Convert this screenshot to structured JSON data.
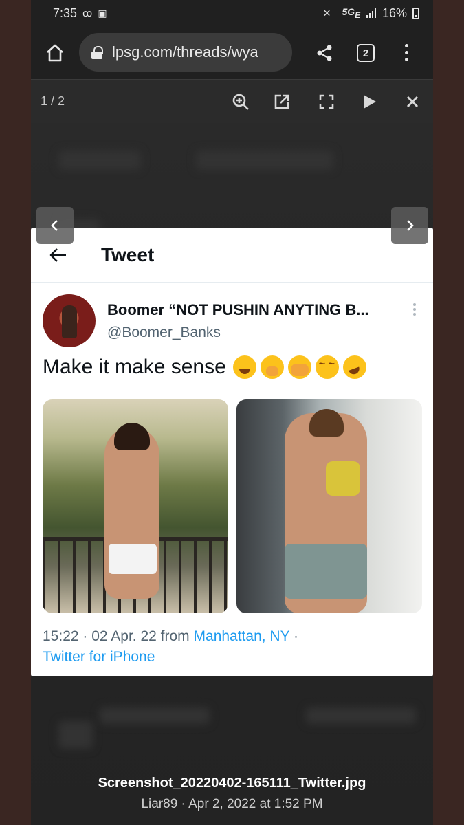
{
  "status_bar": {
    "time": "7:35",
    "network": "5G",
    "network_suffix": "E",
    "battery": "16%"
  },
  "browser": {
    "url": "lpsg.com/threads/wya",
    "tab_count": "2",
    "icons": [
      "home-icon",
      "lock-icon",
      "share-icon",
      "tabs-icon",
      "menu-icon"
    ]
  },
  "lightbox": {
    "counter": "1 / 2",
    "icons": [
      "zoom-in-icon",
      "open-external-icon",
      "fullscreen-icon",
      "play-icon",
      "close-icon"
    ]
  },
  "tweet": {
    "header_title": "Tweet",
    "display_name": "Boomer “NOT PUSHIN ANYTING B...",
    "handle": "@Boomer_Banks",
    "text": "Make it make sense",
    "emojis": [
      "face-with-tears-of-joy",
      "face-with-hand-over-mouth",
      "face-with-open-eyes-and-hand-over-mouth",
      "face-with-spiral-eyes",
      "rolling-on-floor-laughing"
    ],
    "time": "15:22",
    "date": "02 Apr. 22",
    "from_label": "from",
    "location": "Manhattan, NY",
    "source": "Twitter for iPhone",
    "link_color": "#1d9bf0"
  },
  "caption": {
    "filename": "Screenshot_20220402-165111_Twitter.jpg",
    "author": "Liar89",
    "posted": "Apr 2, 2022 at 1:52 PM"
  }
}
